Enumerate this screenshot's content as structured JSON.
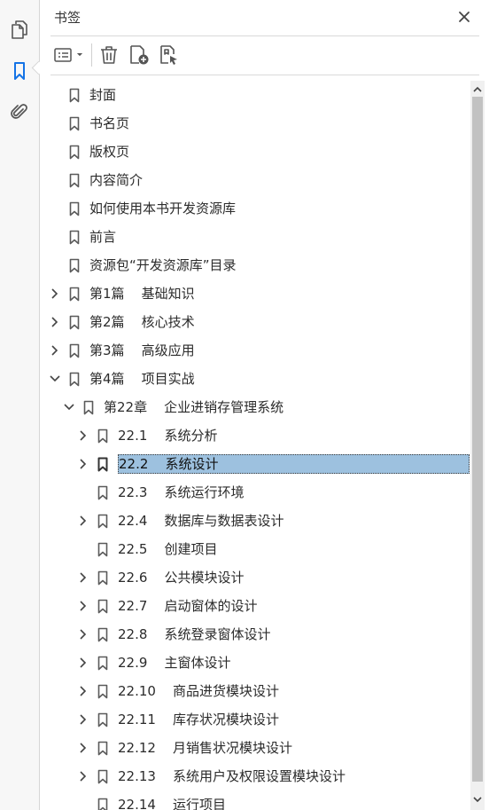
{
  "panel": {
    "title": "书签",
    "colors": {
      "selection_bg": "#9dc1df",
      "accent": "#1473e6"
    }
  },
  "rail_icons": [
    "page-thumbnails-icon",
    "bookmark-icon",
    "paperclip-icon"
  ],
  "toolbar_icons": [
    "options-menu-icon",
    "delete-icon",
    "new-bookmark-icon",
    "bookmark-from-structure-icon"
  ],
  "bookmarks": [
    {
      "label": "封面",
      "level": 0,
      "toggle": "none"
    },
    {
      "label": "书名页",
      "level": 0,
      "toggle": "none"
    },
    {
      "label": "版权页",
      "level": 0,
      "toggle": "none"
    },
    {
      "label": "内容简介",
      "level": 0,
      "toggle": "none"
    },
    {
      "label": "如何使用本书开发资源库",
      "level": 0,
      "toggle": "none"
    },
    {
      "label": "前言",
      "level": 0,
      "toggle": "none"
    },
    {
      "label": "资源包“开发资源库”目录",
      "level": 0,
      "toggle": "none"
    },
    {
      "label": "第1篇    基础知识",
      "level": 0,
      "toggle": "collapsed"
    },
    {
      "label": "第2篇    核心技术",
      "level": 0,
      "toggle": "collapsed"
    },
    {
      "label": "第3篇    高级应用",
      "level": 0,
      "toggle": "collapsed"
    },
    {
      "label": "第4篇    项目实战",
      "level": 0,
      "toggle": "expanded"
    },
    {
      "label": "第22章    企业进销存管理系统",
      "level": 1,
      "toggle": "expanded"
    },
    {
      "label": "22.1    系统分析",
      "level": 2,
      "toggle": "collapsed"
    },
    {
      "label": "22.2    系统设计",
      "level": 2,
      "toggle": "collapsed",
      "selected": true
    },
    {
      "label": "22.3    系统运行环境",
      "level": 2,
      "toggle": "none"
    },
    {
      "label": "22.4    数据库与数据表设计",
      "level": 2,
      "toggle": "collapsed"
    },
    {
      "label": "22.5    创建项目",
      "level": 2,
      "toggle": "none"
    },
    {
      "label": "22.6    公共模块设计",
      "level": 2,
      "toggle": "collapsed"
    },
    {
      "label": "22.7    启动窗体的设计",
      "level": 2,
      "toggle": "collapsed"
    },
    {
      "label": "22.8    系统登录窗体设计",
      "level": 2,
      "toggle": "collapsed"
    },
    {
      "label": "22.9    主窗体设计",
      "level": 2,
      "toggle": "collapsed"
    },
    {
      "label": "22.10    商品进货模块设计",
      "level": 2,
      "toggle": "collapsed"
    },
    {
      "label": "22.11    库存状况模块设计",
      "level": 2,
      "toggle": "collapsed"
    },
    {
      "label": "22.12    月销售状况模块设计",
      "level": 2,
      "toggle": "collapsed"
    },
    {
      "label": "22.13    系统用户及权限设置模块设计",
      "level": 2,
      "toggle": "collapsed"
    },
    {
      "label": "22.14    运行项目",
      "level": 2,
      "toggle": "none"
    }
  ]
}
